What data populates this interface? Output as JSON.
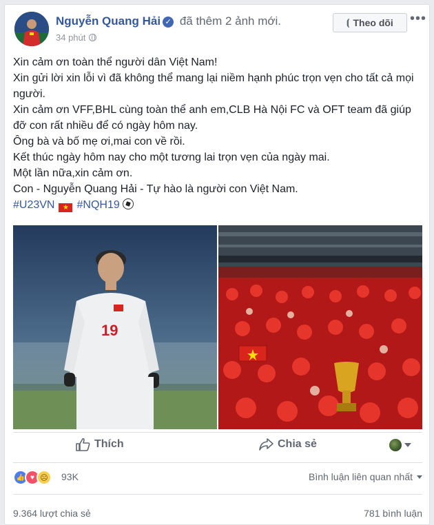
{
  "post": {
    "author": "Nguyễn Quang Hải",
    "action": "đã thêm 2 ảnh mới.",
    "time": "34 phút",
    "follow_label": "Theo dõi",
    "more_label": "•••",
    "lines": [
      "Xin cảm ơn toàn thể người dân Việt Nam!",
      "Xin gửi lời xin lỗi vì đã không thể mang lại niềm hạnh phúc trọn vẹn cho tất cả mọi người.",
      "Xin cảm ơn VFF,BHL cùng toàn thể anh em,CLB Hà Nội FC và OFT team đã giúp đỡ con rất nhiều để có ngày hôm nay.",
      "Ông bà và bố mẹ ơi,mai con về rồi.",
      "Kết thúc ngày hôm nay cho một tương lai trọn vẹn của ngày mai.",
      "Một lần nữa,xin cảm ơn.",
      "Con - Nguyễn Quang Hải - Tự hào là người con Việt Nam."
    ],
    "hashtags": [
      "#U23VN",
      "#NQH19"
    ],
    "photo_left_number": "19"
  },
  "actions": {
    "like_label": "Thích",
    "share_label": "Chia sẻ"
  },
  "reactions": {
    "count": "93K",
    "sort_label": "Bình luận liên quan nhất"
  },
  "footer": {
    "shares": "9.364 lượt chia sẻ",
    "comments": "781 bình luận"
  }
}
